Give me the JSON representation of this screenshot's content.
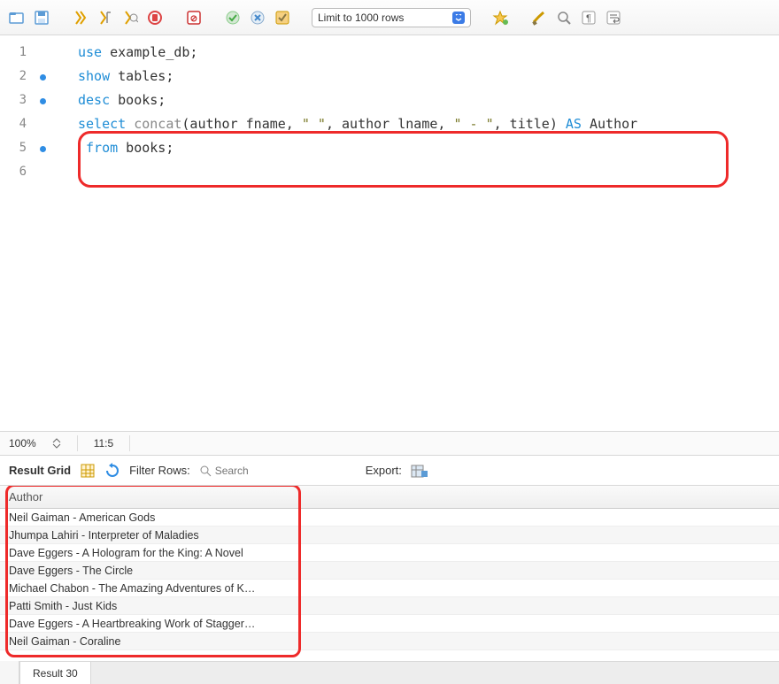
{
  "toolbar": {
    "limit_label": "Limit to 1000 rows"
  },
  "editor": {
    "lines": [
      {
        "n": "1",
        "bp": false,
        "tokens": [
          [
            "kw",
            "use"
          ],
          [
            "t",
            " example_db;"
          ]
        ]
      },
      {
        "n": "2",
        "bp": true,
        "tokens": [
          [
            "kw",
            "show"
          ],
          [
            "t",
            " tables;"
          ]
        ]
      },
      {
        "n": "3",
        "bp": true,
        "tokens": [
          [
            "kw",
            "desc"
          ],
          [
            "t",
            " books;"
          ]
        ]
      },
      {
        "n": "4",
        "bp": false,
        "tokens": []
      },
      {
        "n": "5",
        "bp": true,
        "hl": true,
        "tokens": [
          [
            "kw",
            "select"
          ],
          [
            "t",
            " "
          ],
          [
            "fn",
            "concat"
          ],
          [
            "t",
            "(author_fname, "
          ],
          [
            "str",
            "\" \""
          ],
          [
            "t",
            ", author_lname, "
          ],
          [
            "str",
            "\" - \""
          ],
          [
            "t",
            ", title) "
          ],
          [
            "kw",
            "AS"
          ],
          [
            "t",
            " Author"
          ]
        ]
      },
      {
        "n": "6",
        "bp": false,
        "tokens": [
          [
            "t",
            " "
          ],
          [
            "kw",
            "from"
          ],
          [
            "t",
            " books;"
          ]
        ]
      }
    ]
  },
  "statusbar": {
    "zoom": "100%",
    "pos": "11:5"
  },
  "results": {
    "label": "Result Grid",
    "filter_label": "Filter Rows:",
    "search_placeholder": "Search",
    "export_label": "Export:",
    "column": "Author",
    "rows": [
      "Neil Gaiman - American Gods",
      "Jhumpa Lahiri - Interpreter of Maladies",
      "Dave Eggers - A Hologram for the King: A Novel",
      "Dave Eggers - The Circle",
      "Michael Chabon - The Amazing Adventures of K…",
      "Patti Smith - Just Kids",
      "Dave Eggers - A Heartbreaking Work of Stagger…",
      "Neil Gaiman - Coraline"
    ]
  },
  "tabs": {
    "result_tab": "Result 30"
  }
}
